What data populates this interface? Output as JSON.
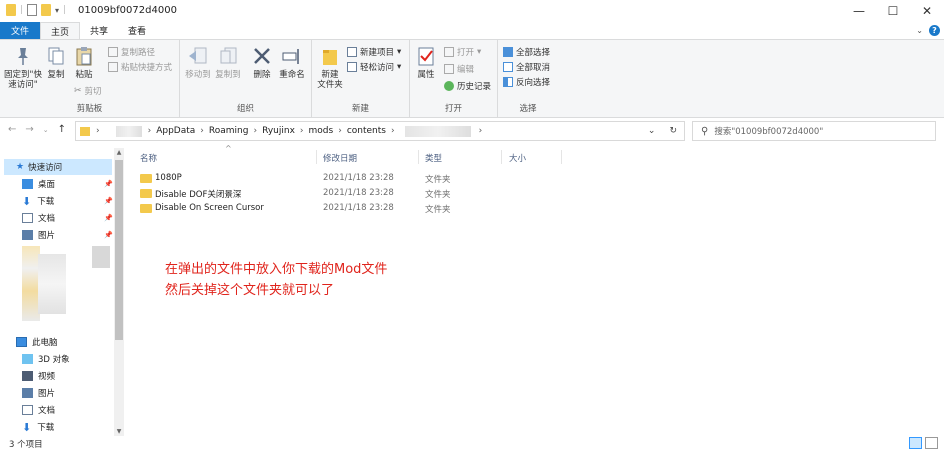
{
  "window": {
    "title": "01009bf0072d4000",
    "minimize": "—",
    "maximize": "☐",
    "close": "✕"
  },
  "tabs": [
    "文件",
    "主页",
    "共享",
    "查看"
  ],
  "ribbon": {
    "clipboard": {
      "label": "剪贴板",
      "pin": "固定到'快\n速访问",
      "pin_line1": "固定到\"快",
      "pin_line2": "速访问\"",
      "copy": "复制",
      "paste": "粘贴",
      "copy_path": "复制路径",
      "paste_shortcut": "粘贴快捷方式",
      "cut": "剪切"
    },
    "organize": {
      "label": "组织",
      "move_to": "移动到",
      "copy_to": "复制到",
      "delete": "删除",
      "rename": "重命名"
    },
    "new": {
      "label": "新建",
      "new_folder_line1": "新建",
      "new_folder_line2": "文件夹",
      "new_item": "新建项目",
      "easy_access": "轻松访问"
    },
    "open": {
      "label": "打开",
      "properties": "属性",
      "open": "打开",
      "edit": "编辑",
      "history": "历史记录"
    },
    "select": {
      "label": "选择",
      "select_all": "全部选择",
      "select_none": "全部取消",
      "invert": "反向选择"
    }
  },
  "address": {
    "crumbs": [
      "AppData",
      "Roaming",
      "Ryujinx",
      "mods",
      "contents"
    ],
    "search_placeholder": "搜索\"01009bf0072d4000\""
  },
  "nav": {
    "quick_access": "快速访问",
    "quick_items": [
      "桌面",
      "下载",
      "文档",
      "图片"
    ],
    "this_pc": "此电脑",
    "pc_items": [
      "3D 对象",
      "视频",
      "图片",
      "文档",
      "下载"
    ]
  },
  "columns": {
    "name": "名称",
    "date": "修改日期",
    "type": "类型",
    "size": "大小"
  },
  "files": [
    {
      "name": "1080P",
      "date": "2021/1/18 23:28",
      "type": "文件夹"
    },
    {
      "name": "Disable DOF关闭景深",
      "date": "2021/1/18 23:28",
      "type": "文件夹"
    },
    {
      "name": "Disable On Screen Cursor",
      "date": "2021/1/18 23:28",
      "type": "文件夹"
    }
  ],
  "annotation": {
    "line1": "在弹出的文件中放入你下载的Mod文件",
    "line2": "然后关掉这个文件夹就可以了"
  },
  "status": {
    "count": "3 个项目"
  },
  "colors": {
    "accent": "#1979ca",
    "annotation": "#e0241c",
    "folder": "#f3c94c"
  }
}
